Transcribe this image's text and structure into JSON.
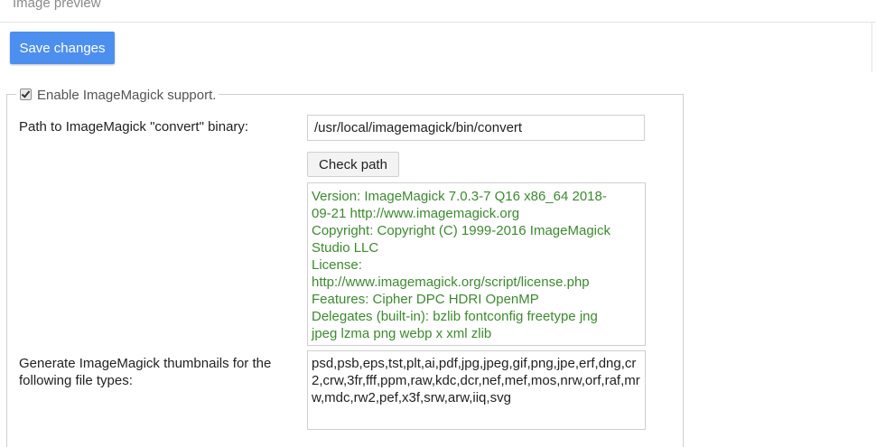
{
  "header": {
    "section_title": "Image preview"
  },
  "toolbar": {
    "save_label": "Save changes"
  },
  "imagemagick": {
    "enable_label": "Enable ImageMagick support.",
    "enabled": true,
    "path_label": "Path to ImageMagick \"convert\" binary:",
    "path_value": "/usr/local/imagemagick/bin/convert",
    "check_path_label": "Check path",
    "version_lines": [
      "Version: ImageMagick 7.0.3-7 Q16 x86_64 2018-",
      "09-21 http://www.imagemagick.org",
      "Copyright: Copyright (C) 1999-2016 ImageMagick",
      "Studio LLC",
      "License:",
      "http://www.imagemagick.org/script/license.php",
      "Features: Cipher DPC HDRI OpenMP",
      "Delegates (built-in): bzlib fontconfig freetype jng",
      "jpeg lzma png webp x xml zlib"
    ],
    "thumbnails_label_line1": "Generate ImageMagick thumbnails for the",
    "thumbnails_label_line2": "following file types:",
    "file_types": "psd,psb,eps,tst,plt,ai,pdf,jpg,jpeg,gif,png,jpe,erf,dng,cr2,crw,3fr,fff,ppm,raw,kdc,dcr,nef,mef,mos,nrw,orf,raf,mrw,mdc,rw2,pef,x3f,srw,arw,iiq,svg"
  },
  "colors": {
    "primary_button": "#4d8fef",
    "version_text": "#3c8a2e"
  }
}
